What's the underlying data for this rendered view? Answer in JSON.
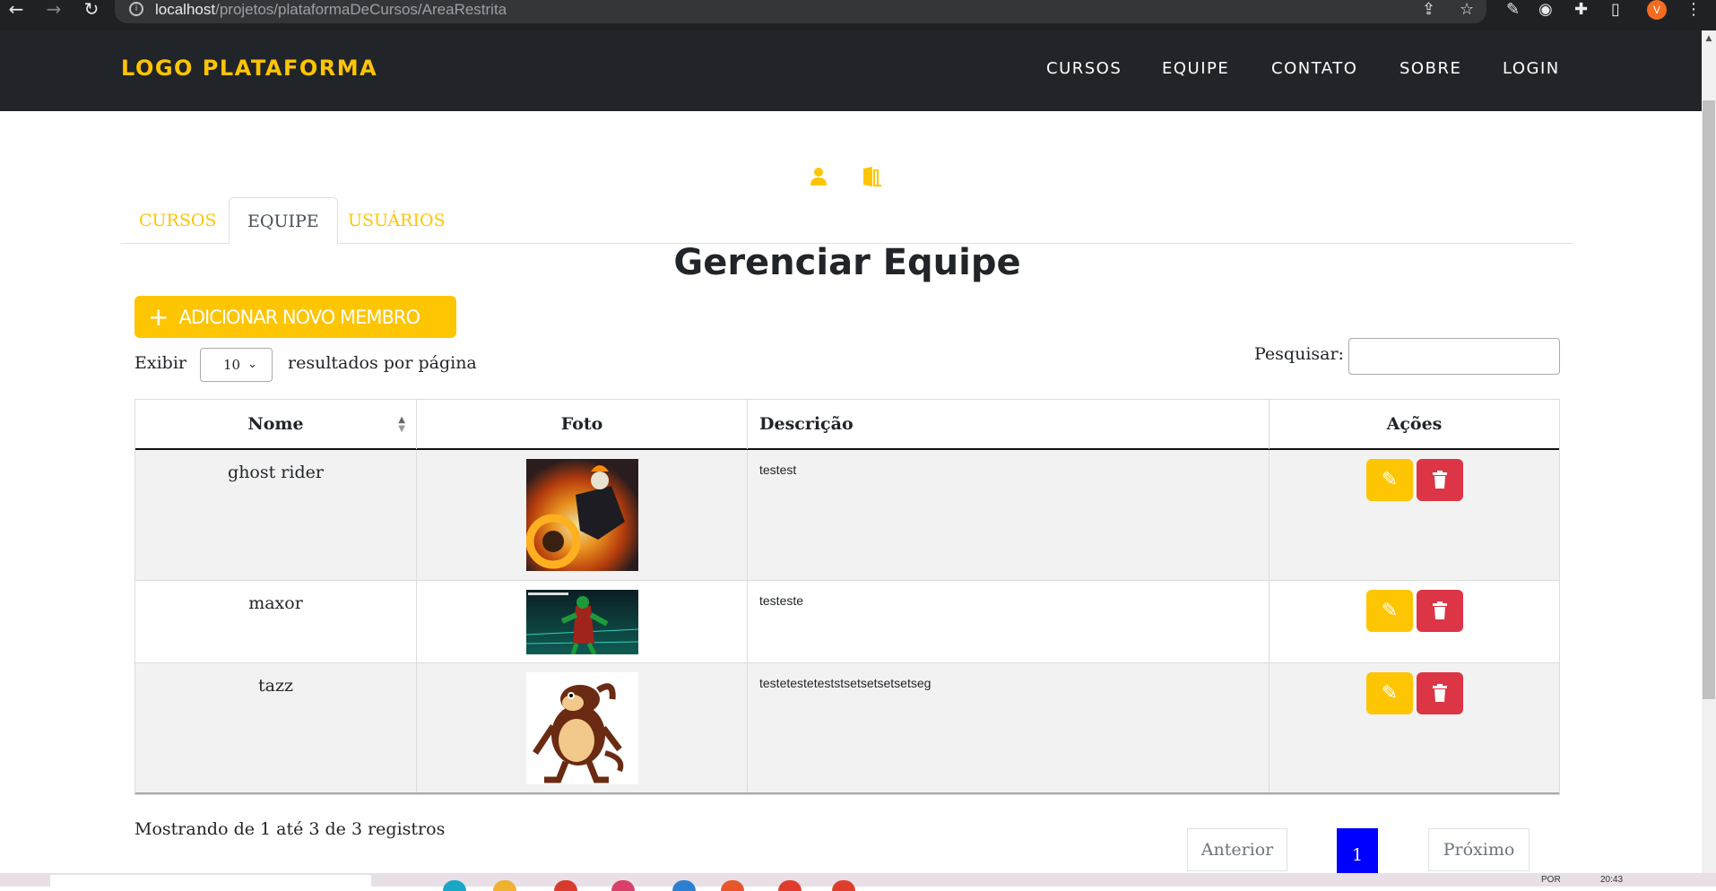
{
  "browser": {
    "url_host": "localhost",
    "url_path": "/projetos/plataformaDeCursos/AreaRestrita",
    "profile_initial": "V"
  },
  "navbar": {
    "logo": "LOGO PLATAFORMA",
    "links": [
      "CURSOS",
      "EQUIPE",
      "CONTATO",
      "SOBRE",
      "LOGIN"
    ]
  },
  "tabs": [
    "CURSOS",
    "EQUIPE",
    "USUÁRIOS"
  ],
  "active_tab": "EQUIPE",
  "page_title": "Gerenciar Equipe",
  "add_button": "ADICIONAR NOVO MEMBRO",
  "length_menu": {
    "before": "Exibir",
    "value": "10",
    "after": "resultados por página"
  },
  "search": {
    "label": "Pesquisar:",
    "value": ""
  },
  "table": {
    "headers": [
      "Nome",
      "Foto",
      "Descrição",
      "Ações"
    ],
    "rows": [
      {
        "name": "ghost rider",
        "description": "testest",
        "photo": "ghost-rider-image"
      },
      {
        "name": "maxor",
        "description": "testeste",
        "photo": "green-alien-image"
      },
      {
        "name": "tazz",
        "description": "testetesteteststsetsetsetsetseg",
        "photo": "tazmanian-devil-image"
      }
    ]
  },
  "footer": {
    "info": "Mostrando de 1 até 3 de 3 registros",
    "prev": "Anterior",
    "current_page": "1",
    "next": "Próximo"
  },
  "taskbar": {
    "lang": "POR",
    "time": "20:43"
  },
  "colors": {
    "accent": "#fec503",
    "navbar": "#212529",
    "danger": "#dc3545",
    "page_current": "#0000ff"
  }
}
